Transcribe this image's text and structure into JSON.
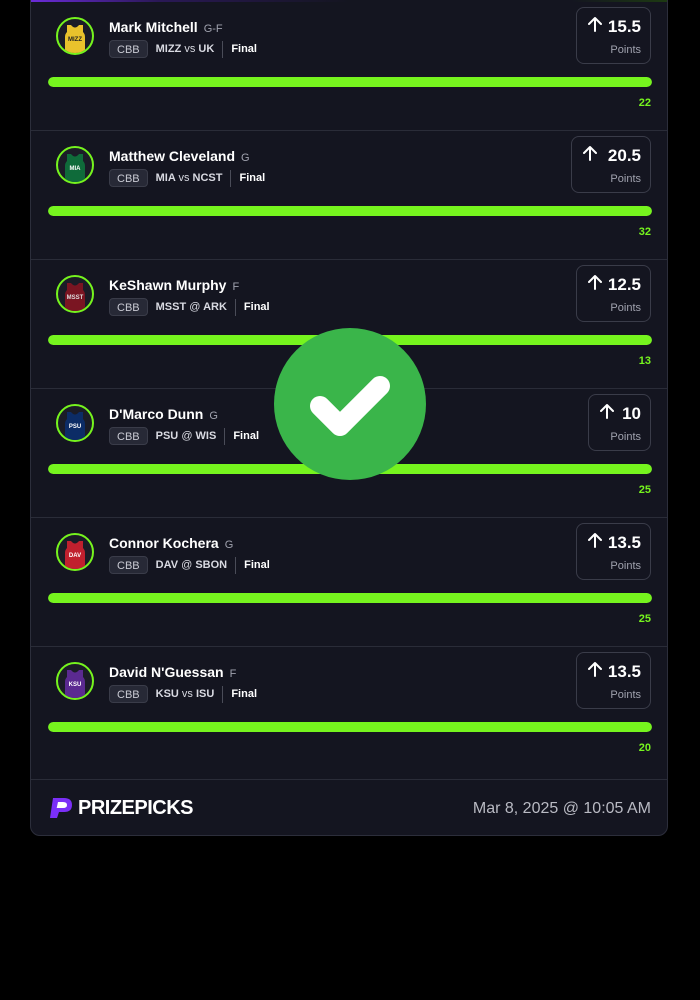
{
  "players": [
    {
      "name": "Mark Mitchell",
      "position": "G-F",
      "league": "CBB",
      "team": "MIZZ",
      "sep": "vs",
      "opponent": "UK",
      "status": "Final",
      "line": "15.5",
      "stat": "Points",
      "actual": "22",
      "progress": 1.0,
      "jersey_color": "#e9c22c",
      "jersey_text_color": "#222222"
    },
    {
      "name": "Matthew Cleveland",
      "position": "G",
      "league": "CBB",
      "team": "MIA",
      "sep": "vs",
      "opponent": "NCST",
      "status": "Final",
      "line": "20.5",
      "stat": "Points",
      "actual": "32",
      "progress": 1.0,
      "jersey_color": "#0f6b3a",
      "jersey_text_color": "#ffffff"
    },
    {
      "name": "KeShawn Murphy",
      "position": "F",
      "league": "CBB",
      "team": "MSST",
      "sep": "@",
      "opponent": "ARK",
      "status": "Final",
      "line": "12.5",
      "stat": "Points",
      "actual": "13",
      "progress": 1.0,
      "jersey_color": "#7a1522",
      "jersey_text_color": "#dddddd"
    },
    {
      "name": "D'Marco Dunn",
      "position": "G",
      "league": "CBB",
      "team": "PSU",
      "sep": "@",
      "opponent": "WIS",
      "status": "Final",
      "line": "10",
      "stat": "Points",
      "actual": "25",
      "progress": 1.0,
      "jersey_color": "#0c2c66",
      "jersey_text_color": "#ffffff"
    },
    {
      "name": "Connor Kochera",
      "position": "G",
      "league": "CBB",
      "team": "DAV",
      "sep": "@",
      "opponent": "SBON",
      "status": "Final",
      "line": "13.5",
      "stat": "Points",
      "actual": "25",
      "progress": 1.0,
      "jersey_color": "#c1202e",
      "jersey_text_color": "#ffffff"
    },
    {
      "name": "David N'Guessan",
      "position": "F",
      "league": "CBB",
      "team": "KSU",
      "sep": "vs",
      "opponent": "ISU",
      "status": "Final",
      "line": "13.5",
      "stat": "Points",
      "actual": "20",
      "progress": 1.0,
      "jersey_color": "#5b2a91",
      "jersey_text_color": "#ffffff"
    }
  ],
  "footer": {
    "brand": "PRIZEPICKS",
    "timestamp": "Mar 8, 2025 @ 10:05 AM"
  },
  "colors": {
    "accent": "#76f41e",
    "brand": "#7b2ff7",
    "success": "#3ab54a"
  }
}
